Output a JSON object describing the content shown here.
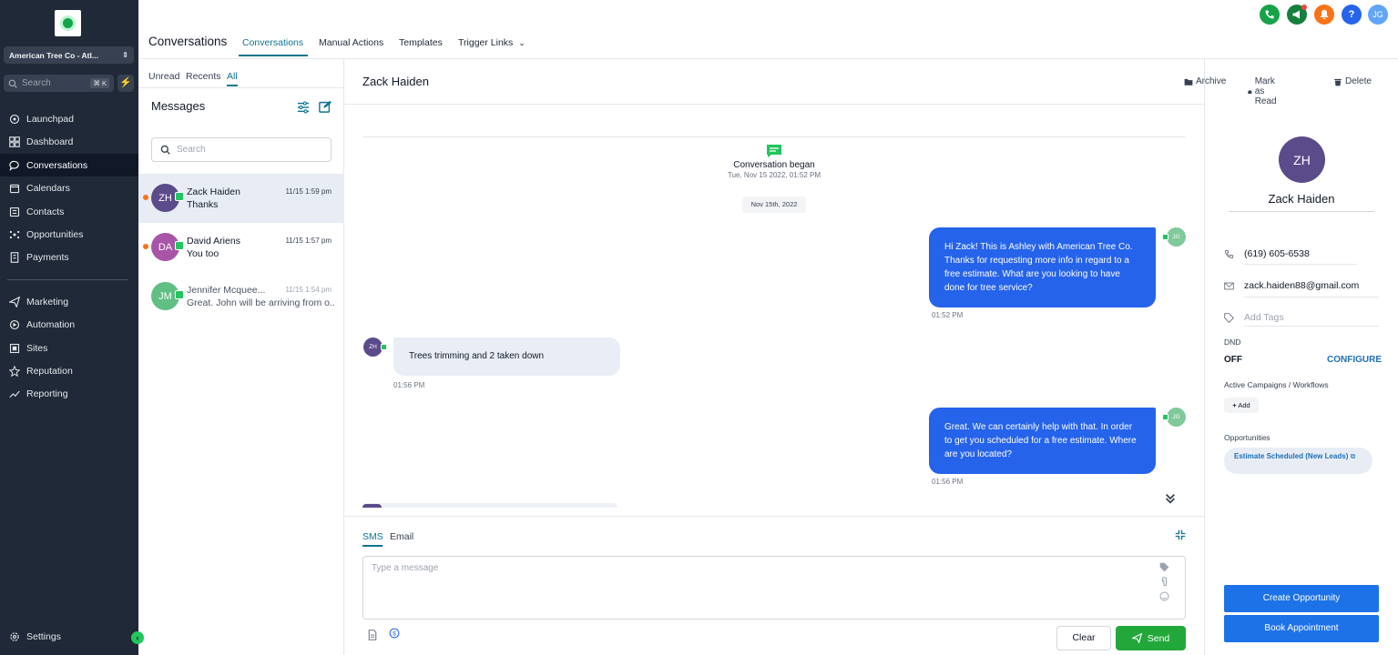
{
  "sidebar": {
    "account": "American Tree Co - Atl...",
    "search_placeholder": "Search",
    "search_shortcut": "⌘ K",
    "items": [
      {
        "label": "Launchpad"
      },
      {
        "label": "Dashboard"
      },
      {
        "label": "Conversations"
      },
      {
        "label": "Calendars"
      },
      {
        "label": "Contacts"
      },
      {
        "label": "Opportunities"
      },
      {
        "label": "Payments"
      },
      {
        "label": "Marketing"
      },
      {
        "label": "Automation"
      },
      {
        "label": "Sites"
      },
      {
        "label": "Reputation"
      },
      {
        "label": "Reporting"
      }
    ],
    "settings": "Settings"
  },
  "header": {
    "title": "Conversations",
    "tabs": [
      "Conversations",
      "Manual Actions",
      "Templates",
      "Trigger Links"
    ],
    "user_initials": "JG"
  },
  "list": {
    "filters": [
      "Unread",
      "Recents",
      "All"
    ],
    "title": "Messages",
    "search_placeholder": "Search",
    "conversations": [
      {
        "initials": "ZH",
        "name": "Zack Haiden",
        "time": "11/15 1:59 pm",
        "preview": "Thanks"
      },
      {
        "initials": "DA",
        "name": "David Ariens",
        "time": "11/15 1:57 pm",
        "preview": "You too"
      },
      {
        "initials": "JM",
        "name": "Jennifer Mcquee...",
        "time": "11/15 1:54 pm",
        "preview": "Great. John will be arriving from o..."
      }
    ]
  },
  "chat": {
    "contact_name": "Zack Haiden",
    "actions": {
      "archive": "Archive",
      "mark_read": "Mark as Read",
      "delete": "Delete"
    },
    "began_title": "Conversation began",
    "began_date": "Tue, Nov 15 2022, 01:52 PM",
    "date_chip": "Nov 15th, 2022",
    "messages": [
      {
        "text": "Hi Zack! This is Ashley with American Tree Co. Thanks for requesting more info in regard to a free estimate. What are you looking to have done for tree service?",
        "time": "01:52 PM",
        "initials": "JG"
      },
      {
        "text": "Trees trimming and 2 taken down",
        "time": "01:56 PM",
        "initials": "ZH"
      },
      {
        "text": "Great. We can certainly help with that. In order to get you scheduled for a free estimate. Where are you located?",
        "time": "01:56 PM",
        "initials": "JG"
      }
    ],
    "composer": {
      "tabs": [
        "SMS",
        "Email"
      ],
      "placeholder": "Type a message",
      "clear": "Clear",
      "send": "Send"
    }
  },
  "contact": {
    "initials": "ZH",
    "name": "Zack Haiden",
    "phone": "(619) 605-6538",
    "email": "zack.haiden88@gmail.com",
    "tags_placeholder": "Add Tags",
    "dnd_label": "DND",
    "dnd_value": "OFF",
    "configure": "CONFIGURE",
    "campaigns_label": "Active Campaigns / Workflows",
    "add": "Add",
    "opportunities_label": "Opportunities",
    "opportunity": "Estimate Scheduled (New Leads)",
    "create_opportunity": "Create Opportunity",
    "book_appointment": "Book Appointment"
  },
  "colors": {
    "sidebar_bg": "#1f2937",
    "accent": "#0e7490",
    "bubble_out": "#2563eb",
    "send": "#22a83a",
    "primary_button": "#1d72e8"
  }
}
